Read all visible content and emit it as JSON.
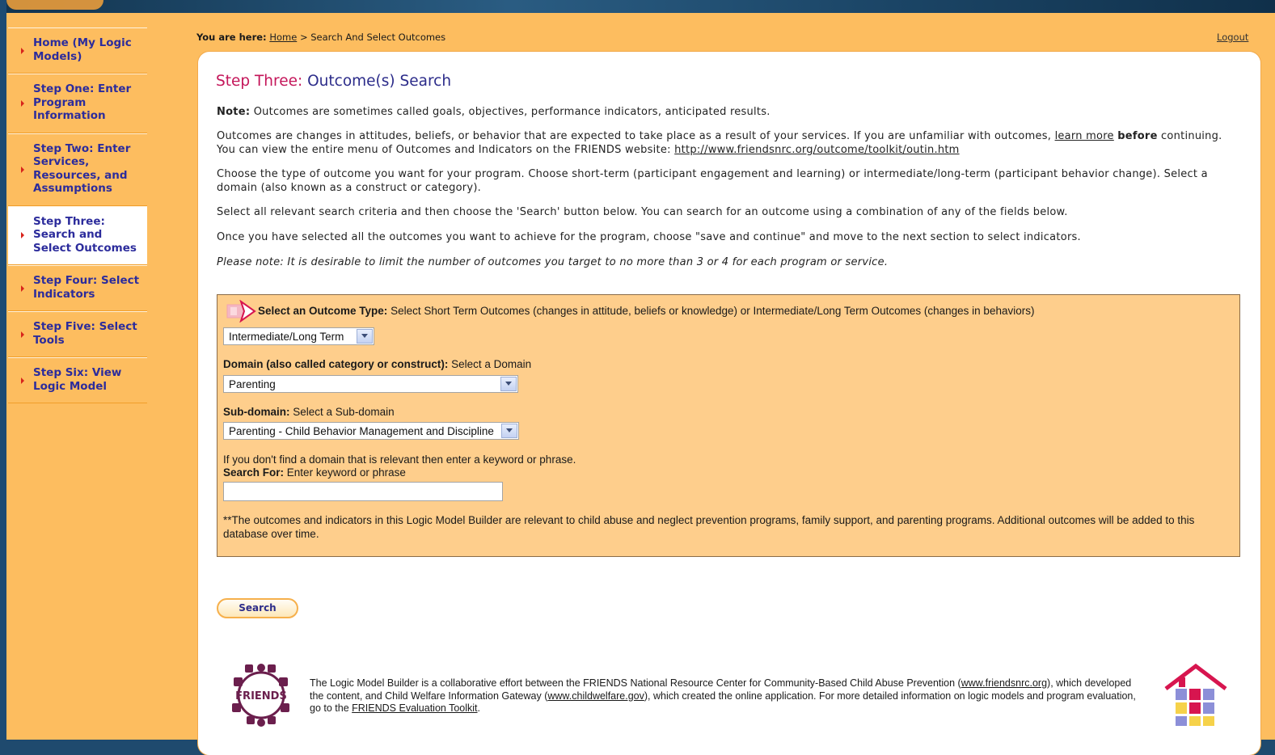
{
  "nav": {
    "items": [
      {
        "label": "Home (My Logic Models)",
        "active": false
      },
      {
        "label": "Step One: Enter Program Information",
        "active": false
      },
      {
        "label": "Step Two: Enter Services, Resources, and Assumptions",
        "active": false
      },
      {
        "label": "Step Three: Search and Select Outcomes",
        "active": true
      },
      {
        "label": "Step Four: Select Indicators",
        "active": false
      },
      {
        "label": "Step Five: Select Tools",
        "active": false
      },
      {
        "label": "Step Six: View Logic Model",
        "active": false
      }
    ]
  },
  "breadcrumb": {
    "prefix": "You are here:",
    "home": "Home",
    "separator": ">",
    "current": "Search And Select Outcomes"
  },
  "header": {
    "logout": "Logout"
  },
  "page": {
    "title_step": "Step Three:",
    "title_rest": "Outcome(s) Search",
    "note_label": "Note:",
    "note_text": "Outcomes are sometimes called goals, objectives, performance indicators, anticipated results.",
    "para1_a": "Outcomes are changes in attitudes, beliefs, or behavior that are expected to take place as a result of your services. If you are unfamiliar with outcomes,",
    "para1_link": "learn more",
    "para1_bold": "before",
    "para1_b": "continuing. You can view the entire menu of Outcomes and Indicators on the FRIENDS website:",
    "para1_url": "http://www.friendsnrc.org/outcome/toolkit/outin.htm",
    "para2": "Choose the type of outcome you want for your program. Choose short-term (participant engagement and learning) or intermediate/long-term (participant behavior change). Select a domain (also known as a construct or category).",
    "para3": "Select all relevant search criteria and then choose the 'Search' button below. You can search for an outcome using a combination of any of the fields below.",
    "para4": "Once you have selected all the outcomes you want to achieve for the program, choose \"save and continue\" and move to the next section to select indicators.",
    "para5": "Please note: It is desirable to limit the number of outcomes you target to no more than 3 or 4 for each program or service."
  },
  "search_form": {
    "outcome_type_label": "Select an Outcome Type:",
    "outcome_type_help": "Select Short Term Outcomes (changes in attitude, beliefs or knowledge) or Intermediate/Long Term Outcomes (changes in behaviors)",
    "outcome_type_value": "Intermediate/Long Term",
    "domain_label": "Domain (also called category or construct):",
    "domain_help": "Select a Domain",
    "domain_value": "Parenting",
    "subdomain_label": "Sub-domain:",
    "subdomain_help": "Select a Sub-domain",
    "subdomain_value": "Parenting - Child Behavior Management and Discipline",
    "keyword_hint": "If you don't find a domain that is relevant then enter a keyword or phrase.",
    "search_for_label": "Search For:",
    "search_for_help": "Enter keyword or phrase",
    "search_for_value": "",
    "disclaimer": "**The outcomes and indicators in this Logic Model Builder are relevant to child abuse and neglect prevention programs, family support, and parenting programs. Additional outcomes will be added to this database over time."
  },
  "search_button": "Search",
  "footer": {
    "text_a": "The Logic Model Builder is a collaborative effort between the FRIENDS National Resource Center for Community-Based Child Abuse Prevention (",
    "link_friends": "www.friendsnrc.org",
    "text_b": "), which developed the content, and Child Welfare Information Gateway (",
    "link_cw": "www.childwelfare.gov",
    "text_c": "), which created the online application. For more detailed information on logic models and program evaluation, go to the",
    "link_toolkit": "FRIENDS Evaluation Toolkit",
    "text_d": ".",
    "logo_text": "FRIENDS"
  },
  "colors": {
    "sidebar_bg": "#fdbd5f",
    "nav_text": "#2c2c9c",
    "title_step": "#c4165a",
    "form_bg": "#fece8c"
  },
  "icons": [
    "nav-arrow-icon",
    "outcome-arrow-icon",
    "chevron-down-icon",
    "friends-logo",
    "house-logo"
  ]
}
